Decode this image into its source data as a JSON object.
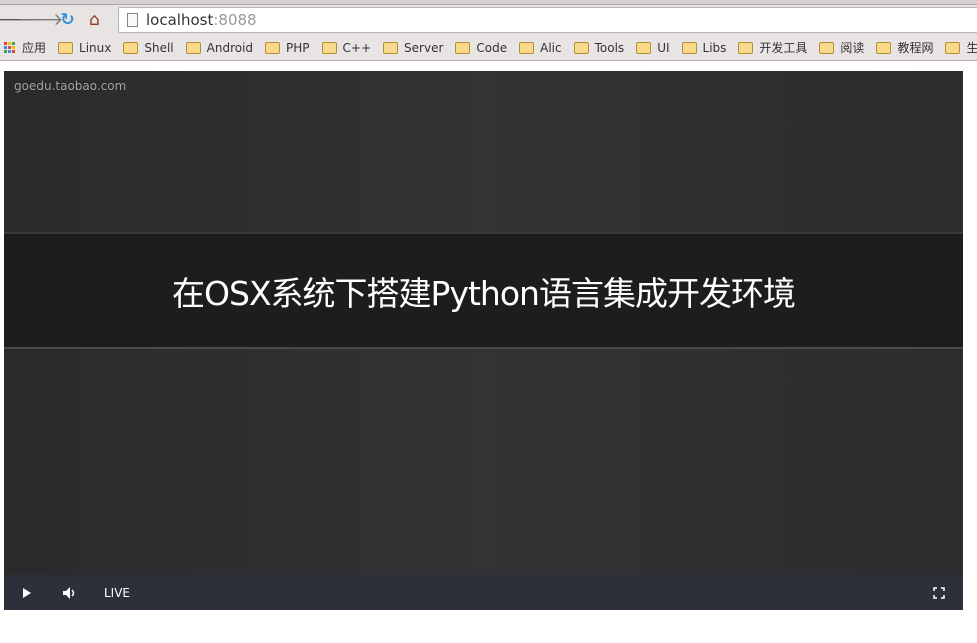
{
  "browser": {
    "url_host": "localhost",
    "url_port": ":8088",
    "bookmarks": [
      {
        "label": "应用",
        "type": "apps"
      },
      {
        "label": "Linux"
      },
      {
        "label": "Shell"
      },
      {
        "label": "Android"
      },
      {
        "label": "PHP"
      },
      {
        "label": "C++"
      },
      {
        "label": "Server"
      },
      {
        "label": "Code"
      },
      {
        "label": "Alic"
      },
      {
        "label": "Tools"
      },
      {
        "label": "UI"
      },
      {
        "label": "Libs"
      },
      {
        "label": "开发工具"
      },
      {
        "label": "阅读"
      },
      {
        "label": "教程网"
      },
      {
        "label": "生活"
      },
      {
        "label": ""
      }
    ]
  },
  "video": {
    "watermark": "goedu.taobao.com",
    "title": "在OSX系统下搭建Python语言集成开发环境",
    "controls": {
      "live_label": "LIVE",
      "play_icon": "play-icon",
      "volume_icon": "volume-icon",
      "fullscreen_icon": "fullscreen-icon"
    }
  }
}
